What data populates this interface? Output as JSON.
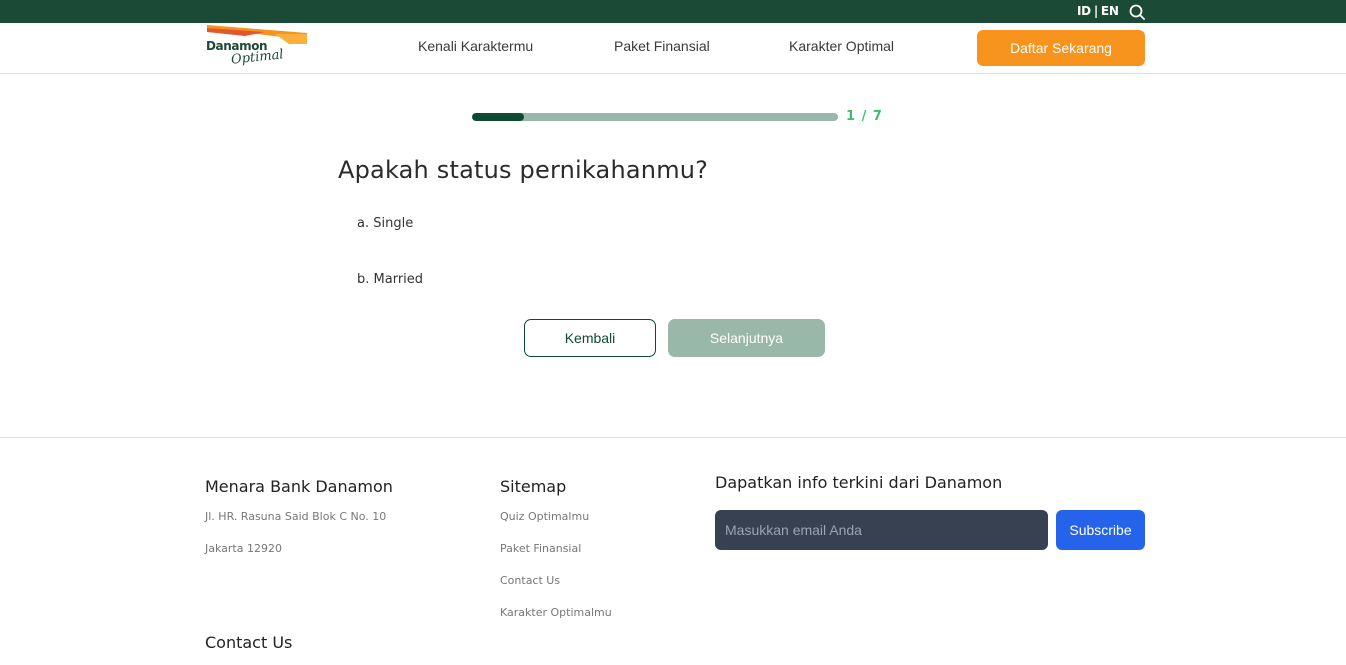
{
  "header": {
    "lang_id": "ID",
    "lang_sep": "|",
    "lang_en": "EN",
    "logo_text": "Danamon",
    "logo_script": "Optimal",
    "nav": [
      "Kenali Karaktermu",
      "Paket Finansial",
      "Karakter Optimal"
    ],
    "cta_label": "Daftar Sekarang"
  },
  "quiz": {
    "progress_fraction": 0.143,
    "progress_label": "1 / 7",
    "question": "Apakah status pernikahanmu?",
    "options": [
      "a. Single",
      "b. Married"
    ],
    "back_label": "Kembali",
    "next_label": "Selanjutnya"
  },
  "footer": {
    "address_title": "Menara Bank Danamon",
    "address_line1": "Jl. HR. Rasuna Said Blok C No. 10",
    "address_line2": "Jakarta 12920",
    "contact_title": "Contact Us",
    "sitemap_title": "Sitemap",
    "sitemap_links": [
      "Quiz Optimalmu",
      "Paket Finansial",
      "Contact Us",
      "Karakter Optimalmu"
    ],
    "newsletter_title": "Dapatkan info terkini dari Danamon",
    "email_placeholder": "Masukkan email Anda",
    "subscribe_label": "Subscribe"
  },
  "colors": {
    "brand_green": "#1b4a37",
    "accent_orange": "#f7941d",
    "progress_done": "#0f4a34",
    "progress_track": "#9ab8aa",
    "progress_text": "#3ebf6b",
    "subscribe_blue": "#2563eb"
  },
  "icons": {
    "search": "search-icon",
    "logo": "danamon-logo"
  }
}
